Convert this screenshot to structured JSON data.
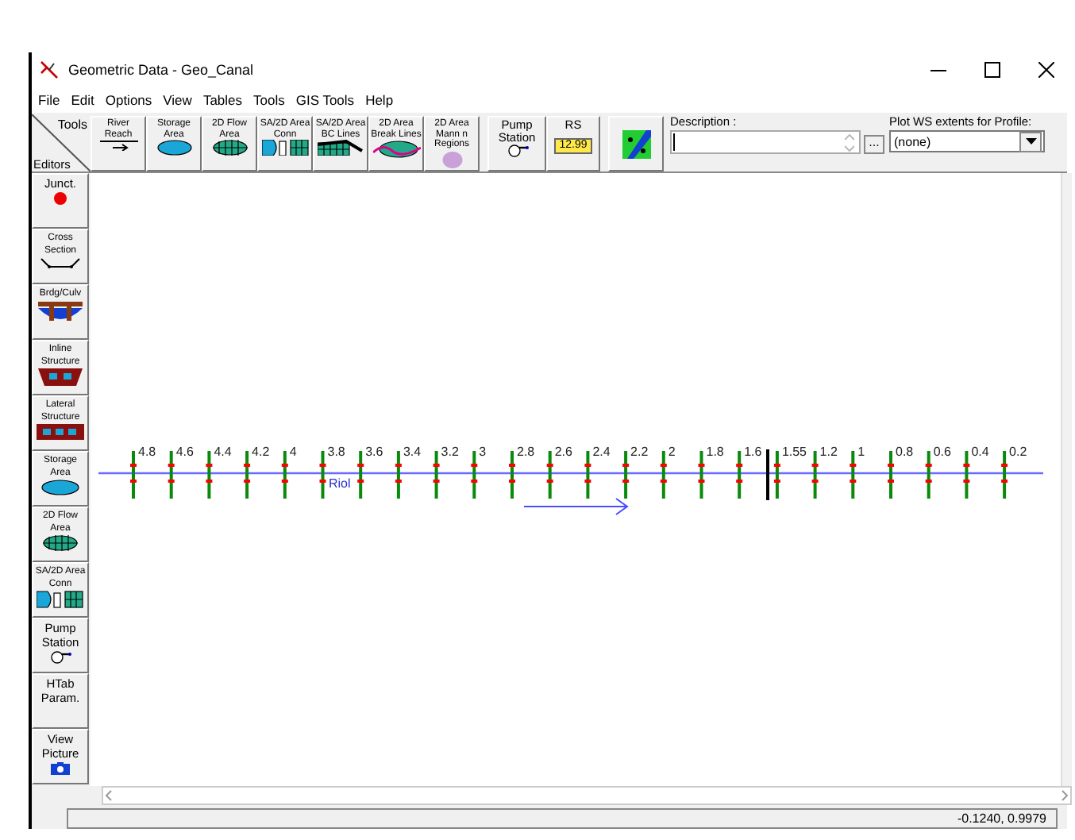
{
  "window": {
    "title": "Geometric Data - Geo_Canal"
  },
  "menu": [
    "File",
    "Edit",
    "Options",
    "View",
    "Tables",
    "Tools",
    "GIS Tools",
    "Help"
  ],
  "toolbar": {
    "corner_top": "Tools",
    "corner_bottom": "Editors",
    "tools": [
      {
        "lines": [
          "River",
          "Reach"
        ]
      },
      {
        "lines": [
          "Storage",
          "Area"
        ]
      },
      {
        "lines": [
          "2D Flow",
          "Area"
        ]
      },
      {
        "lines": [
          "SA/2D Area",
          "Conn"
        ]
      },
      {
        "lines": [
          "SA/2D Area",
          "BC Lines"
        ]
      },
      {
        "lines": [
          "2D Area",
          "Break Lines"
        ]
      },
      {
        "lines": [
          "2D Area",
          "Mann n",
          "Regions"
        ]
      }
    ],
    "pump_station": [
      "Pump",
      "Station"
    ],
    "rs": {
      "label": "RS",
      "value": "12.99"
    },
    "description": {
      "label": "Description :",
      "browse": "..."
    },
    "plot_ws": {
      "label": "Plot WS extents for Profile:",
      "value": "(none)"
    }
  },
  "editors": [
    {
      "lines": [
        "Junct."
      ]
    },
    {
      "lines": [
        "Cross",
        "Section"
      ]
    },
    {
      "lines": [
        "Brdg/Culv"
      ]
    },
    {
      "lines": [
        "Inline",
        "Structure"
      ]
    },
    {
      "lines": [
        "Lateral",
        "Structure"
      ]
    },
    {
      "lines": [
        "Storage",
        "Area"
      ]
    },
    {
      "lines": [
        "2D Flow",
        "Area"
      ]
    },
    {
      "lines": [
        "SA/2D Area",
        "Conn"
      ]
    },
    {
      "lines": [
        "Pump",
        "Station"
      ]
    },
    {
      "lines": [
        "HTab",
        "Param."
      ]
    },
    {
      "lines": [
        "View",
        "Picture"
      ]
    }
  ],
  "canvas": {
    "river_label": "Riol",
    "stations": [
      {
        "kind": "xs",
        "label": "4.8"
      },
      {
        "kind": "xs",
        "label": "4.6"
      },
      {
        "kind": "xs",
        "label": "4.4"
      },
      {
        "kind": "xs",
        "label": "4.2"
      },
      {
        "kind": "xs",
        "label": "4"
      },
      {
        "kind": "xs",
        "label": "3.8"
      },
      {
        "kind": "xs",
        "label": "3.6"
      },
      {
        "kind": "xs",
        "label": "3.4"
      },
      {
        "kind": "xs",
        "label": "3.2"
      },
      {
        "kind": "xs",
        "label": "3"
      },
      {
        "kind": "xs",
        "label": "2.8"
      },
      {
        "kind": "xs",
        "label": "2.6"
      },
      {
        "kind": "xs",
        "label": "2.4"
      },
      {
        "kind": "xs",
        "label": "2.2"
      },
      {
        "kind": "xs",
        "label": "2"
      },
      {
        "kind": "xs",
        "label": "1.8"
      },
      {
        "kind": "xs",
        "label": "1.6"
      },
      {
        "kind": "structure"
      },
      {
        "kind": "xs",
        "label": "1.55"
      },
      {
        "kind": "xs",
        "label": "1.2"
      },
      {
        "kind": "xs",
        "label": "1"
      },
      {
        "kind": "xs",
        "label": "0.8"
      },
      {
        "kind": "xs",
        "label": "0.6"
      },
      {
        "kind": "xs",
        "label": "0.4"
      },
      {
        "kind": "xs",
        "label": "0.2"
      }
    ]
  },
  "status_bar": {
    "coordinates": "-0.1240, 0.9979"
  }
}
